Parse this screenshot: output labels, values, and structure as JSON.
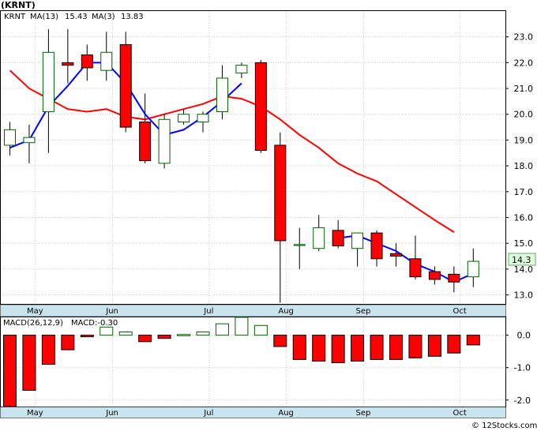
{
  "chart_data": [
    {
      "type": "candlestick",
      "title": "(KRNT)",
      "legend": [
        {
          "text": "KRNT",
          "color": "#008000"
        },
        {
          "text": "MA(13)",
          "color": "#0000ff"
        },
        {
          "text": "15.43",
          "color": "#0000ff"
        },
        {
          "text": "MA(3)",
          "color": "#0000ff"
        },
        {
          "text": "13.83",
          "color": "#0000ff"
        }
      ],
      "ylim": [
        12.65,
        24.0
      ],
      "yticks": [
        "23.0",
        "22.0",
        "21.0",
        "20.0",
        "19.0",
        "18.0",
        "17.0",
        "16.0",
        "15.0",
        "14.0",
        "13.0"
      ],
      "last_price": "14.3",
      "x_month_labels": [
        {
          "label": "May",
          "week": 1.3
        },
        {
          "label": "Jun",
          "week": 5.3
        },
        {
          "label": "Jul",
          "week": 10.3
        },
        {
          "label": "Aug",
          "week": 14.3
        },
        {
          "label": "Sep",
          "week": 18.3
        },
        {
          "label": "Oct",
          "week": 23.3
        }
      ],
      "month_gridlines": [
        1.3,
        5.3,
        10.3,
        14.3,
        18.3,
        23.3
      ],
      "weeks": [
        0,
        1,
        2,
        3,
        4,
        5,
        6,
        7,
        8,
        9,
        10,
        11,
        12,
        13,
        14,
        15,
        16,
        17,
        18,
        19,
        20,
        21,
        22,
        23,
        24
      ],
      "candles": [
        {
          "o": 18.8,
          "h": 19.7,
          "l": 18.4,
          "c": 19.4
        },
        {
          "o": 18.9,
          "h": 19.6,
          "l": 18.1,
          "c": 19.1
        },
        {
          "o": 20.1,
          "h": 23.3,
          "l": 18.5,
          "c": 22.4
        },
        {
          "o": 22.0,
          "h": 23.3,
          "l": 21.2,
          "c": 21.9
        },
        {
          "o": 22.3,
          "h": 22.7,
          "l": 21.3,
          "c": 21.8
        },
        {
          "o": 21.7,
          "h": 23.2,
          "l": 21.3,
          "c": 22.4
        },
        {
          "o": 22.7,
          "h": 23.2,
          "l": 19.3,
          "c": 19.5
        },
        {
          "o": 19.7,
          "h": 20.8,
          "l": 18.1,
          "c": 18.2
        },
        {
          "o": 18.1,
          "h": 20.0,
          "l": 17.9,
          "c": 19.8
        },
        {
          "o": 19.7,
          "h": 20.2,
          "l": 19.6,
          "c": 20.0
        },
        {
          "o": 19.7,
          "h": 20.1,
          "l": 19.3,
          "c": 20.0
        },
        {
          "o": 20.1,
          "h": 21.9,
          "l": 19.8,
          "c": 21.4
        },
        {
          "o": 21.6,
          "h": 22.0,
          "l": 21.4,
          "c": 21.9
        },
        {
          "o": 22.0,
          "h": 22.1,
          "l": 18.5,
          "c": 18.6
        },
        {
          "o": 18.8,
          "h": 19.3,
          "l": 12.7,
          "c": 15.1
        },
        {
          "o": 14.95,
          "h": 15.6,
          "l": 14.0,
          "c": 14.95
        },
        {
          "o": 14.8,
          "h": 16.1,
          "l": 14.7,
          "c": 15.6
        },
        {
          "o": 15.5,
          "h": 15.9,
          "l": 14.8,
          "c": 14.9
        },
        {
          "o": 14.8,
          "h": 15.4,
          "l": 14.1,
          "c": 15.4
        },
        {
          "o": 15.4,
          "h": 15.5,
          "l": 14.1,
          "c": 14.4
        },
        {
          "o": 14.6,
          "h": 15.0,
          "l": 14.1,
          "c": 14.5
        },
        {
          "o": 14.4,
          "h": 15.3,
          "l": 13.6,
          "c": 13.7
        },
        {
          "o": 13.9,
          "h": 14.1,
          "l": 13.4,
          "c": 13.6
        },
        {
          "o": 13.8,
          "h": 14.1,
          "l": 13.1,
          "c": 13.5
        },
        {
          "o": 13.7,
          "h": 14.8,
          "l": 13.3,
          "c": 14.3
        }
      ],
      "series": [
        {
          "name": "MA(13)",
          "color": "#ff0000",
          "start_week": 0,
          "values": [
            21.7,
            21.0,
            20.6,
            20.2,
            20.1,
            20.2,
            19.9,
            19.8,
            20.0,
            20.2,
            20.4,
            20.7,
            20.6,
            20.3,
            19.8,
            19.2,
            18.7,
            18.1,
            17.7,
            17.4,
            16.9,
            16.4,
            15.9,
            15.43
          ]
        },
        {
          "name": "MA(3)",
          "color": "#0000ff",
          "start_week": 0,
          "values": [
            18.7,
            19.0,
            20.3,
            21.1,
            22.0,
            22.0,
            21.2,
            20.0,
            19.2,
            19.4,
            19.9,
            20.5,
            21.2,
            21.0,
            19.5,
            16.2,
            15.2,
            15.2,
            15.3,
            15.0,
            14.7,
            14.2,
            13.9,
            13.5,
            13.83
          ]
        }
      ],
      "ma3_gaps": [
        13,
        14,
        15,
        16
      ]
    },
    {
      "type": "bar",
      "title": "MACD(26,12,9)",
      "legend": [
        {
          "text": "MACD(26,12,9)",
          "color": "#000000"
        },
        {
          "text": "MACD:-0.30",
          "color": "#0000ff"
        }
      ],
      "ylim": [
        -2.2,
        0.55
      ],
      "yticks": [
        "0.0",
        "-1.0",
        "-2.0"
      ],
      "weeks": [
        0,
        1,
        2,
        3,
        4,
        5,
        6,
        7,
        8,
        9,
        10,
        11,
        12,
        13,
        14,
        15,
        16,
        17,
        18,
        19,
        20,
        21,
        22,
        23,
        24
      ],
      "values": [
        -2.25,
        -1.7,
        -0.9,
        -0.45,
        -0.05,
        0.25,
        0.1,
        -0.2,
        -0.1,
        0.02,
        0.1,
        0.35,
        0.55,
        0.3,
        -0.35,
        -0.75,
        -0.8,
        -0.85,
        -0.8,
        -0.75,
        -0.75,
        -0.7,
        -0.65,
        -0.55,
        -0.3
      ]
    }
  ]
}
